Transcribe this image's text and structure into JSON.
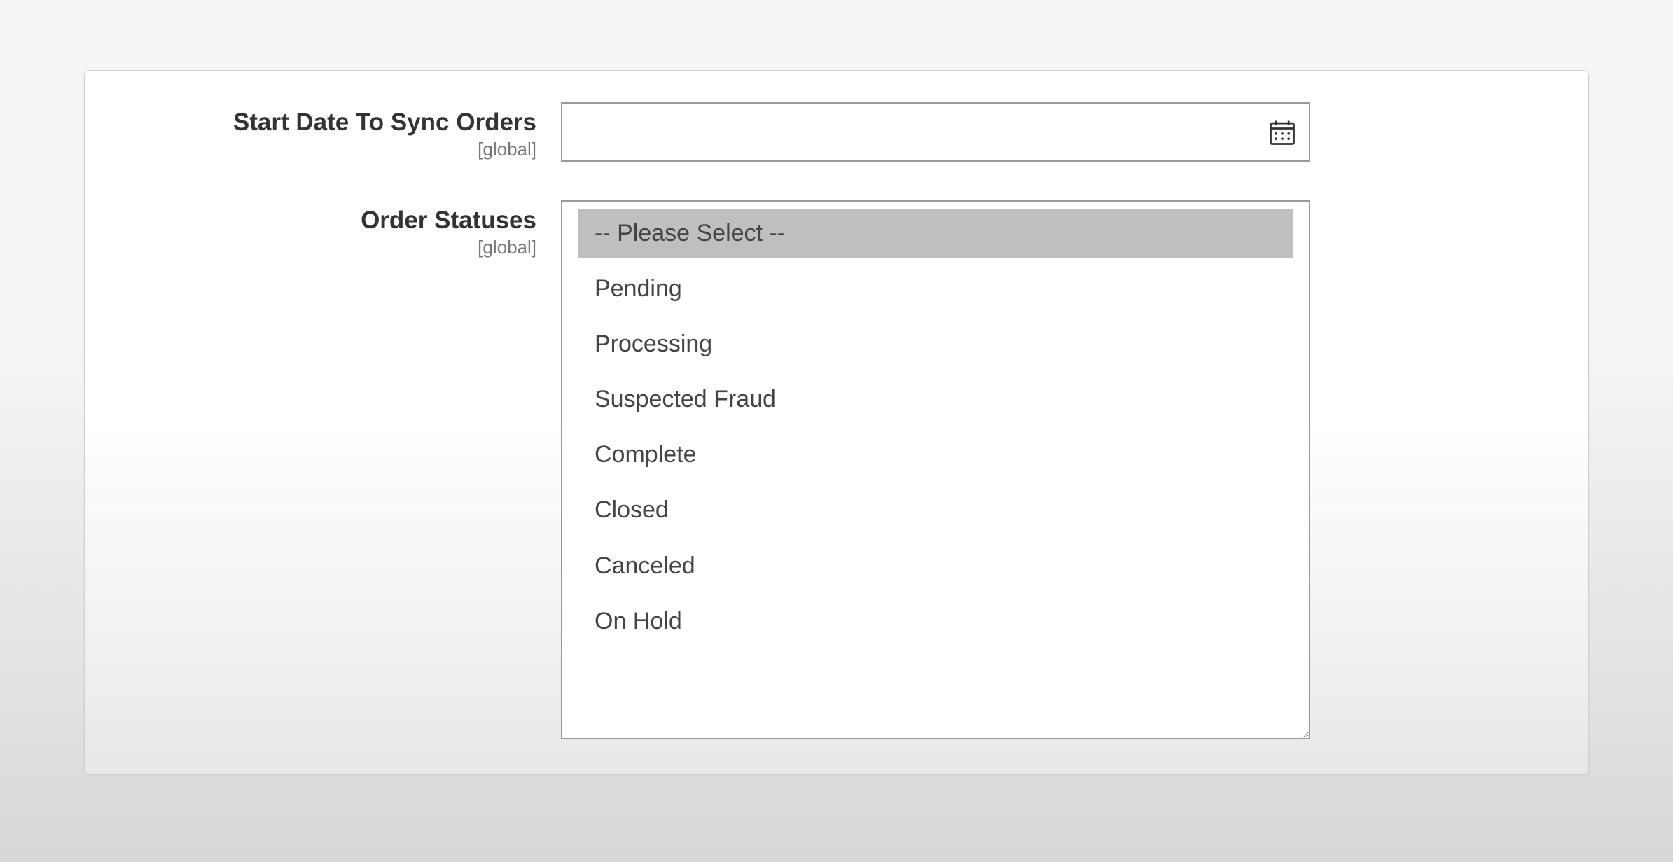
{
  "fields": {
    "start_date": {
      "label": "Start Date To Sync Orders",
      "scope": "[global]",
      "value": ""
    },
    "order_statuses": {
      "label": "Order Statuses",
      "scope": "[global]",
      "options": [
        {
          "label": "-- Please Select --",
          "selected": true
        },
        {
          "label": "Pending",
          "selected": false
        },
        {
          "label": "Processing",
          "selected": false
        },
        {
          "label": "Suspected Fraud",
          "selected": false
        },
        {
          "label": "Complete",
          "selected": false
        },
        {
          "label": "Closed",
          "selected": false
        },
        {
          "label": "Canceled",
          "selected": false
        },
        {
          "label": "On Hold",
          "selected": false
        }
      ]
    }
  }
}
